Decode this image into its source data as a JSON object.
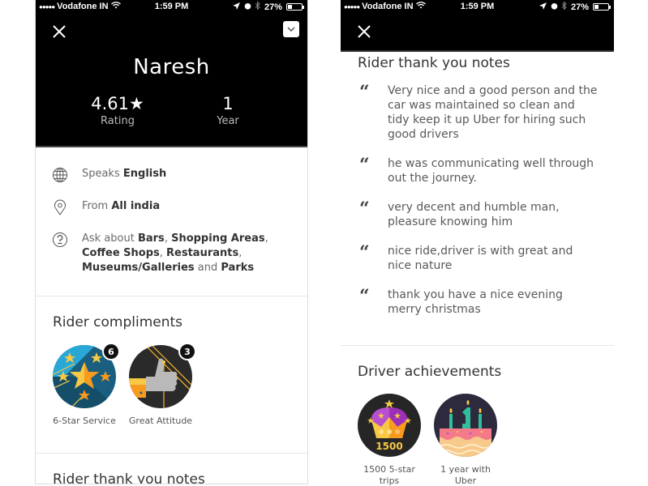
{
  "status_bar": {
    "carrier": "Vodafone IN",
    "signal_dots": "●●●●●",
    "time": "1:59 PM",
    "battery": "27%",
    "battery_level": 0.27
  },
  "left_screen": {
    "driver_name": "Naresh",
    "rating_value": "4.61★",
    "rating_label": "Rating",
    "years_value": "1",
    "years_label": "Year",
    "info": {
      "speaks_prefix": "Speaks ",
      "speaks_value": "English",
      "from_prefix": "From ",
      "from_value": "All india",
      "ask_prefix": "Ask about ",
      "ask_topics": [
        "Bars",
        "Shopping Areas",
        "Coffee Shops",
        "Restaurants",
        "Museums/Galleries",
        "Parks"
      ],
      "ask_and": " and "
    },
    "compliments_title": "Rider compliments",
    "compliments": [
      {
        "label": "6-Star Service",
        "count": "6",
        "icon": "six-star-service-icon"
      },
      {
        "label": "Great Attitude",
        "count": "3",
        "icon": "thumbs-up-icon"
      }
    ],
    "thank_you_title": "Rider thank you notes"
  },
  "right_screen": {
    "thank_you_title": "Rider thank you notes",
    "notes": [
      "Very nice and a good person and the car was maintained so clean and tidy keep it up Uber for hiring such good drivers",
      "he was communicating well through out the journey.",
      "very decent and humble man, pleasure knowing him",
      "nice ride,driver is with great and nice nature",
      "thank you have a nice evening merry christmas"
    ],
    "achievements_title": "Driver achievements",
    "achievements": [
      {
        "label": "1500 5-star trips",
        "badge_text": "1500",
        "icon": "crown-icon"
      },
      {
        "label": "1 year with Uber",
        "badge_text": "1",
        "icon": "birthday-cake-icon"
      }
    ]
  },
  "icons": {
    "close": "close-icon",
    "collapse": "chevron-down-icon",
    "globe": "globe-icon",
    "location": "location-pin-icon",
    "question": "question-icon",
    "quote": "quote-icon"
  },
  "colors": {
    "header_bg": "#000000",
    "text_primary": "#333333",
    "text_secondary": "#6a6a6a",
    "divider": "#e6e6e6"
  }
}
